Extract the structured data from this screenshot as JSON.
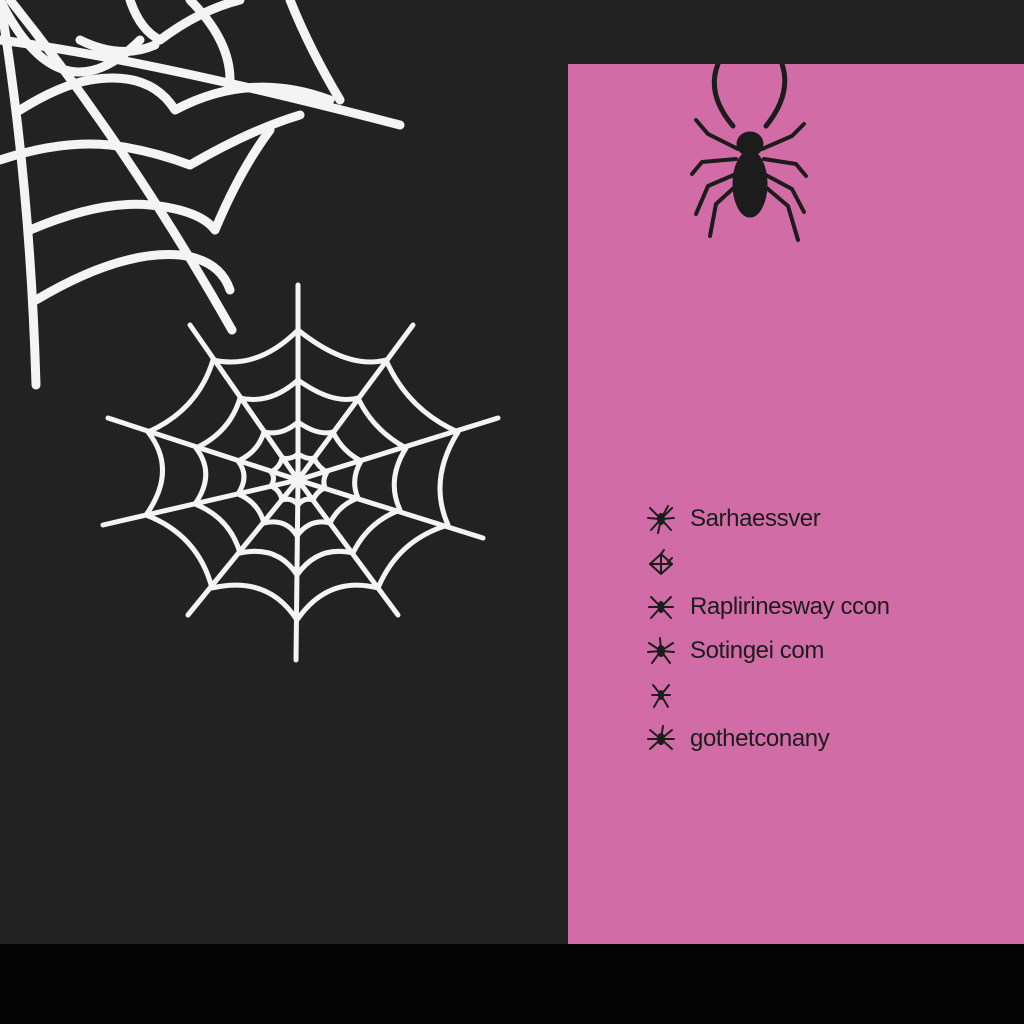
{
  "colors": {
    "background": "#222222",
    "bottom_bar": "#050505",
    "card": "#d26ca7",
    "web": "#f4f4f4",
    "spider": "#1c1c1c",
    "text": "#1c1c1c"
  },
  "card": {
    "items": [
      {
        "icon": "spider-icon",
        "label": "Sarhaessver"
      },
      {
        "icon": "web-icon",
        "label": ""
      },
      {
        "icon": "spider-icon",
        "label": "Raplirinesway ccon"
      },
      {
        "icon": "spider-icon",
        "label": "Sotingei com"
      },
      {
        "icon": "spider-icon",
        "label": ""
      },
      {
        "icon": "spider-icon",
        "label": "gothetconany"
      }
    ]
  }
}
